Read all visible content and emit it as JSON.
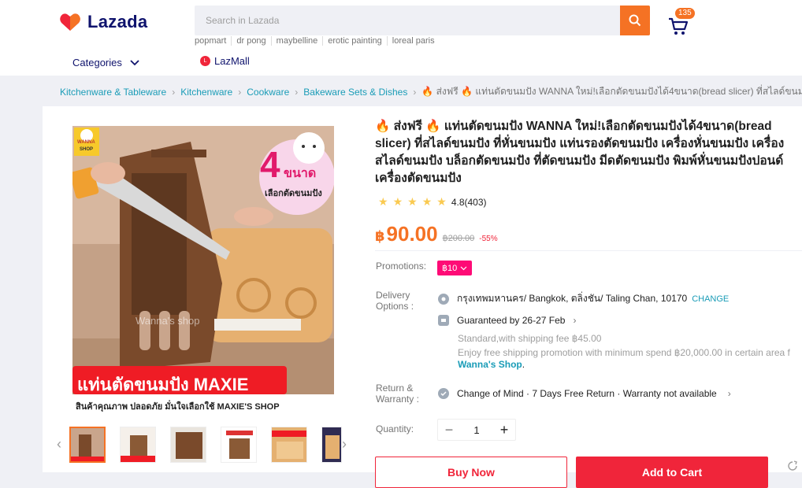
{
  "header": {
    "logo_text": "Lazada",
    "search": {
      "placeholder": "Search in Lazada"
    },
    "suggestions": [
      "popmart",
      "dr pong",
      "maybelline",
      "erotic painting",
      "loreal paris"
    ],
    "cart_count": "135",
    "categories_label": "Categories",
    "lazmall_label": "LazMall"
  },
  "breadcrumb": {
    "items": [
      "Kitchenware & Tableware",
      "Kitchenware",
      "Cookware",
      "Bakeware Sets & Dishes"
    ],
    "current": "🔥 ส่งฟรี 🔥 แท่นตัดขนมปัง WANNA ใหม่!เลือกตัดขนมปังได้4ขนาด(bread slicer) ที่สไลด์ขนมปัง ที่ห"
  },
  "product": {
    "title": "🔥 ส่งฟรี 🔥 แท่นตัดขนมปัง WANNA ใหม่!เลือกตัดขนมปังได้4ขนาด(bread slicer) ที่สไลด์ขนมปัง ที่หั่นขนมปัง แท่นรองตัดขนมปัง เครื่องหั่นขนมปัง เครื่องสไลด์ขนมปัง บล็อกตัดขนมปัง ที่ตัดขนมปัง มีดตัดขนมปัง พิมพ์หั่นขนมปังปอนด์ เครื่องตัดขนมปัง",
    "rating": "4.8(403)",
    "rating_value": 4.8,
    "price_currency": "฿",
    "price": "90.00",
    "old_price": "฿200.00",
    "discount": "-55%",
    "image": {
      "badge_top": "WANNA",
      "badge_bottom": "SHOP",
      "sizes_number": "4",
      "sizes_word": "ขนาด",
      "sizes_sub": "เลือกตัดขนมปัง",
      "watermark": "Wanna's shop",
      "banner": "แท่นตัดขนมปัง MAXIE",
      "caption": "สินค้าคุณภาพ ปลอดภัย มั่นใจเลือกใช้ MAXIE'S SHOP"
    }
  },
  "promotions": {
    "label": "Promotions:",
    "badge": "฿10"
  },
  "delivery": {
    "label_line1": "Delivery",
    "label_line2": "Options :",
    "location": "กรุงเทพมหานคร/ Bangkok, ตลิ่งชัน/ Taling Chan, 10170",
    "change": "CHANGE",
    "guaranteed": "Guaranteed by 26-27 Feb",
    "standard": "Standard,with shipping fee ฿45.00",
    "free_text": "Enjoy free shipping promotion with minimum spend ฿20,000.00 in certain area f",
    "shop": "Wanna's Shop",
    "shop_suffix": "."
  },
  "returns": {
    "label_line1": "Return &",
    "label_line2": "Warranty :",
    "text": "Change of Mind · 7 Days Free Return · Warranty not available"
  },
  "quantity": {
    "label": "Quantity:",
    "value": "1"
  },
  "buttons": {
    "buy_now": "Buy Now",
    "add_to_cart": "Add to Cart"
  },
  "colors": {
    "accent": "#f57224",
    "pink": "#f0253a",
    "link": "#1a9cb7",
    "navy": "#0f136d"
  }
}
